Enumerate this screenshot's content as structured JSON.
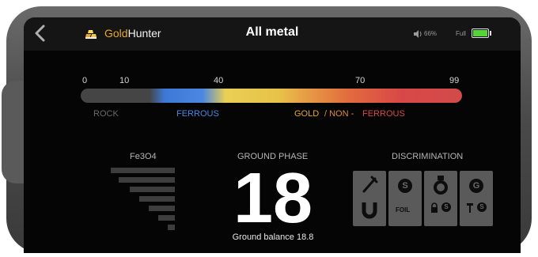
{
  "app": {
    "logo_part1": "Gold",
    "logo_part2": "Hunter",
    "title": "All metal"
  },
  "status": {
    "volume": "66%",
    "battery_label": "Full",
    "accent_color": "#54d43a"
  },
  "scale": {
    "ticks": [
      "0",
      "10",
      "40",
      "70",
      "99"
    ]
  },
  "zones": {
    "rock": "ROCK",
    "ferrous": "FERROUS",
    "gold": "GOLD",
    "separator": "/ NON -",
    "nonferrous": "FERROUS"
  },
  "fe3o4": {
    "label": "Fe3O4"
  },
  "ground": {
    "label": "GROUND PHASE",
    "value": "18",
    "balance": "Ground balance 18.8"
  },
  "discrimination": {
    "label": "DISCRIMINATION",
    "foil": "FOIL"
  }
}
